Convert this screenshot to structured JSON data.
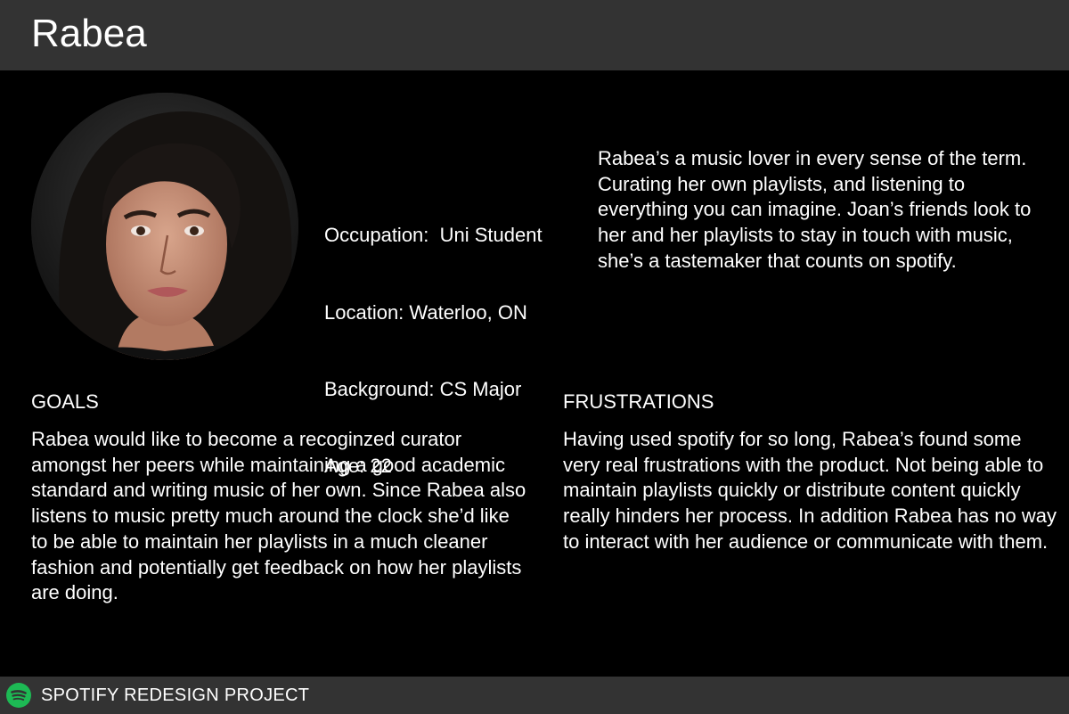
{
  "header": {
    "title": "Rabea"
  },
  "profile": {
    "photo_icon": "portrait-photo",
    "occupation": "Occupation:  Uni Student",
    "location": "Location: Waterloo, ON",
    "background": "Background: CS Major",
    "age": "Age: 22"
  },
  "bio": "Rabea’s a music lover in every sense of the term. Curating her own playlists, and listening to everything you can imagine. Joan’s friends look to her and her playlists to stay in touch with music, she’s a tastemaker that counts on spotify.",
  "goals": {
    "heading": "GOALS",
    "body": "Rabea would like to become a recoginzed curator amongst her peers while maintaining a good academic standard and writing music of her own. Since Rabea also listens to music pretty much around the clock she’d like to be able to maintain her playlists in a much cleaner fashion and potentially get feedback on how her playlists are doing."
  },
  "frustrations": {
    "heading": "FRUSTRATIONS",
    "body": "Having used spotify for so long, Rabea’s found some very real frustrations with the product. Not being able to maintain playlists quickly or distribute content quickly really hinders her process. In addition Rabea has no way to interact with her audience or communicate with them."
  },
  "footer": {
    "logo_icon": "spotify-logo-icon",
    "label": "SPOTIFY REDESIGN PROJECT"
  },
  "colors": {
    "bar": "#333333",
    "background": "#000000",
    "text": "#ffffff",
    "logo_green": "#1db954"
  }
}
